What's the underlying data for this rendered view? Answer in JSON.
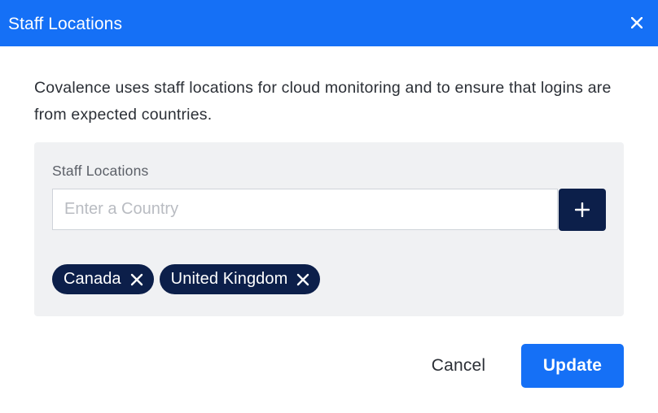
{
  "dialog": {
    "title": "Staff Locations",
    "close_icon": "close-icon",
    "description": "Covalence uses staff locations for cloud monitoring and to ensure that logins are from expected countries."
  },
  "form": {
    "field_label": "Staff Locations",
    "input_placeholder": "Enter a Country",
    "input_value": "",
    "add_icon": "plus-icon"
  },
  "chips": [
    {
      "label": "Canada",
      "remove_icon": "close-icon"
    },
    {
      "label": "United Kingdom",
      "remove_icon": "close-icon"
    }
  ],
  "footer": {
    "cancel_label": "Cancel",
    "update_label": "Update"
  },
  "colors": {
    "header_bg": "#1570f6",
    "primary": "#1570f6",
    "chip_bg": "#0c1f4a",
    "add_button_bg": "#0c1f4a",
    "panel_bg": "#f0f1f3",
    "text": "#2b2f36"
  }
}
